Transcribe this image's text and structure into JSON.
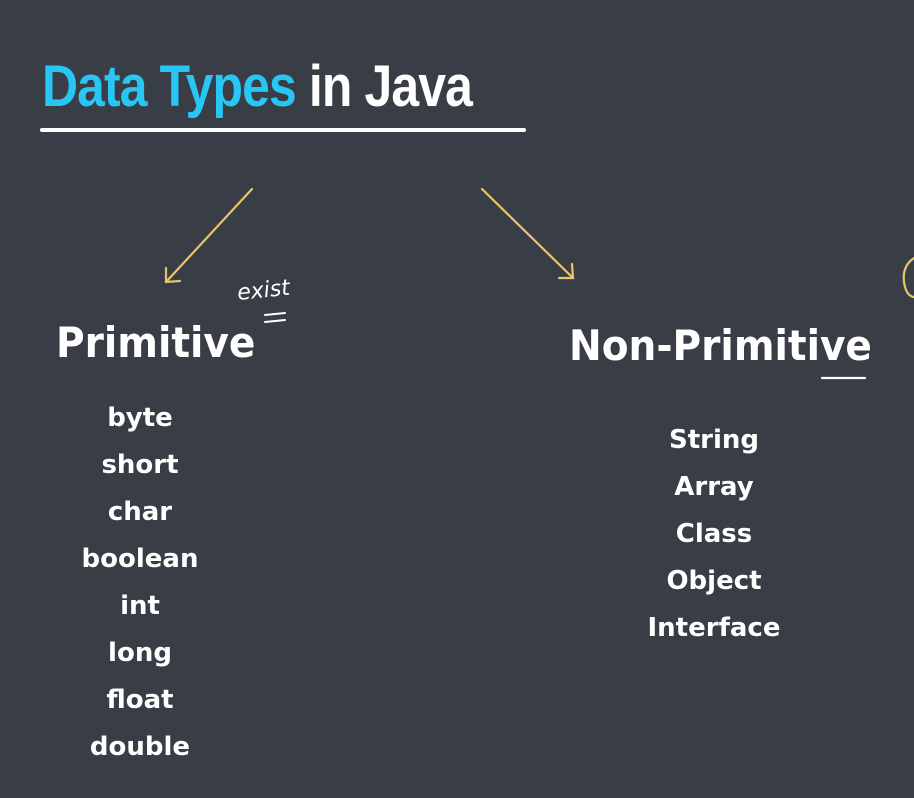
{
  "title": {
    "highlight": "Data Types",
    "rest": " in Java"
  },
  "primitive": {
    "heading": "Primitive",
    "annotation": "exist",
    "types": [
      "byte",
      "short",
      "char",
      "boolean",
      "int",
      "long",
      "float",
      "double"
    ]
  },
  "non_primitive": {
    "heading": "Non-Primitive",
    "types": [
      "String",
      "Array",
      "Class",
      "Object",
      "Interface"
    ]
  },
  "colors": {
    "background": "#383d46",
    "title_accent": "#27c6f4",
    "arrow": "#e8c46a",
    "text": "#ffffff"
  }
}
